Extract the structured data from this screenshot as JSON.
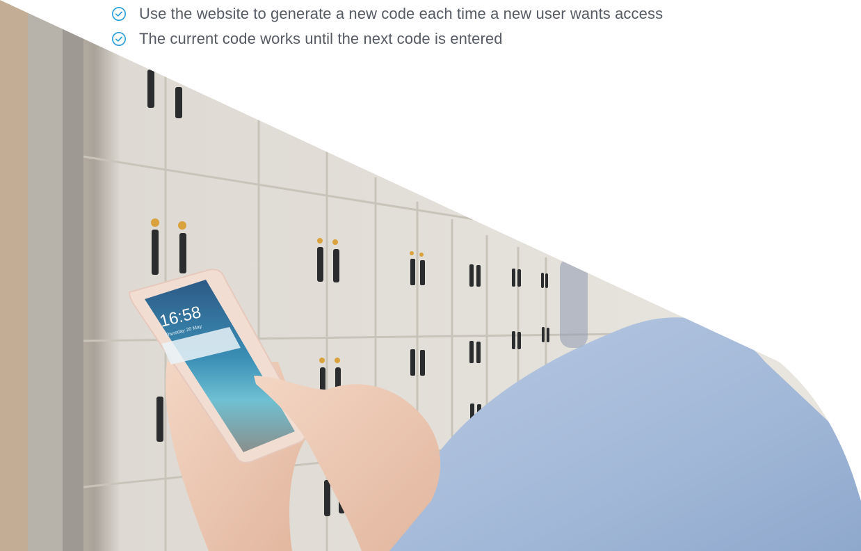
{
  "bullets": [
    {
      "icon": "check-circle-icon",
      "text": "Use the website to generate a new code each time a new user wants access"
    },
    {
      "icon": "check-circle-icon",
      "text": "The current code works until the next code is entered"
    }
  ],
  "phone": {
    "time": "16:58",
    "date": "Thursday 20 May"
  },
  "colors": {
    "accent": "#2a9fd8",
    "text": "#555a63",
    "locker": "#e4e0d8",
    "sleeve": "#a9bfdc"
  }
}
